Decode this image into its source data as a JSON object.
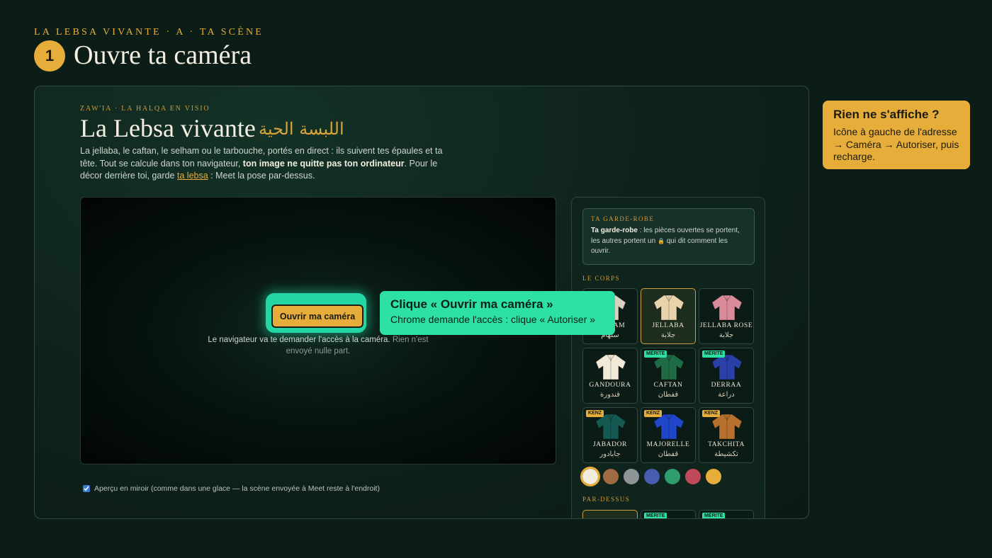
{
  "header": {
    "eyebrow": "LA LEBSA VIVANTE · A · TA SCÈNE",
    "step_number": "1",
    "step_title": "Ouvre ta caméra"
  },
  "app": {
    "kicker": "ZAW'IA · LA HALQA EN VISIO",
    "title": "La Lebsa vivante",
    "title_ar": "اللبسة الحية",
    "intro_1": "La jellaba, le caftan, le selham ou le tarbouche, portés en direct : ils suivent tes épaules et ta tête. Tout se calcule dans ton navigateur, ",
    "intro_bold": "ton image ne quitte pas ton ordinateur",
    "intro_2": ". Pour le décor derrière toi, garde ",
    "intro_link": "ta lebsa",
    "intro_3": " : Meet la pose par-dessus."
  },
  "camera": {
    "button_label": "Ouvrir ma caméra",
    "note_main": "Le navigateur va te demander l'accès à la caméra.",
    "note_dim": " Rien n'est envoyé nulle part."
  },
  "callout": {
    "title": "Clique « Ouvrir ma caméra »",
    "body": "Chrome demande l'accès : clique « Autoriser »"
  },
  "mirror": {
    "checked": true,
    "label": "Aperçu en miroir (comme dans une glace — la scène envoyée à Meet reste à l'endroit)"
  },
  "wardrobe": {
    "kicker": "TA GARDE-ROBE",
    "info_bold": "Ta garde-robe",
    "info_text_1": " : les pièces ouvertes se portent, les autres portent un ",
    "info_lock": "🔒",
    "info_text_2": " qui dit comment les ouvrir.",
    "section_body": "LE CORPS",
    "section_over": "PAR-DESSUS",
    "items": [
      {
        "name": "SELHAM",
        "ar": "سلهام",
        "badge": "",
        "selected": false,
        "color": "#d9d2c3"
      },
      {
        "name": "JELLABA",
        "ar": "جلابة",
        "badge": "",
        "selected": true,
        "color": "#e8d3ad"
      },
      {
        "name": "JELLABA ROSE",
        "ar": "جلابة",
        "badge": "",
        "selected": false,
        "color": "#d98b9a"
      },
      {
        "name": "GANDOURA",
        "ar": "قندورة",
        "badge": "",
        "selected": false,
        "color": "#f1ead9"
      },
      {
        "name": "CAFTAN",
        "ar": "قفطان",
        "badge": "MÉRITE",
        "selected": false,
        "color": "#1f6b45"
      },
      {
        "name": "DERRAA",
        "ar": "دراعة",
        "badge": "MÉRITE",
        "selected": false,
        "color": "#2a3fa8"
      },
      {
        "name": "JABADOR",
        "ar": "جابادور",
        "badge": "KENZ",
        "selected": false,
        "color": "#155a52"
      },
      {
        "name": "MAJORELLE",
        "ar": "قفطان",
        "badge": "KENZ",
        "selected": false,
        "color": "#1f46c9"
      },
      {
        "name": "TAKCHITA",
        "ar": "تكشيطة",
        "badge": "KENZ",
        "selected": false,
        "color": "#b8702f"
      }
    ],
    "over_items": [
      {
        "badge": "",
        "selected": true
      },
      {
        "badge": "MÉRITE",
        "selected": false
      },
      {
        "badge": "MÉRITE",
        "selected": false
      }
    ],
    "swatches": [
      "#f2ecdc",
      "#a06a44",
      "#8e9497",
      "#4a5cb0",
      "#2f9c6f",
      "#c04a5a",
      "#e6ad3a"
    ],
    "active_swatch": 0
  },
  "tip": {
    "title": "Rien ne s'affiche ?",
    "body": "Icône à gauche de l'adresse → Caméra → Autoriser, puis recharge."
  }
}
